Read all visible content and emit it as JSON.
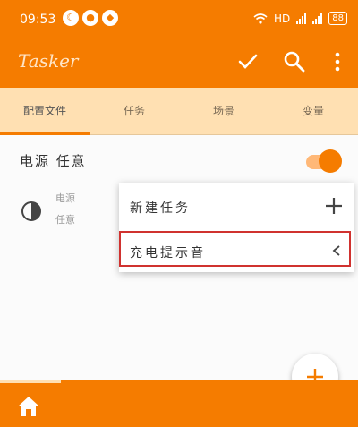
{
  "status_bar": {
    "time": "09:53",
    "right_text": "HD",
    "battery": "88"
  },
  "toolbar": {
    "title": "Tasker",
    "icons": [
      "check-icon",
      "search-icon",
      "more-vert-icon"
    ]
  },
  "tabs": [
    {
      "label": "配置文件",
      "active": true
    },
    {
      "label": "任务",
      "active": false
    },
    {
      "label": "场景",
      "active": false
    },
    {
      "label": "变量",
      "active": false
    }
  ],
  "profile": {
    "title": "电源 任意",
    "enabled": true,
    "task_line1": "电源",
    "task_line2": "任意"
  },
  "popup_menu": {
    "items": [
      {
        "label": "新建任务",
        "icon": "plus-icon"
      },
      {
        "label": "充电提示音",
        "icon": "chevron-left-icon",
        "highlighted": true
      }
    ]
  },
  "colors": {
    "primary": "#f57c00",
    "tab_bg": "#ffe0b2",
    "highlight": "#d0322f"
  }
}
